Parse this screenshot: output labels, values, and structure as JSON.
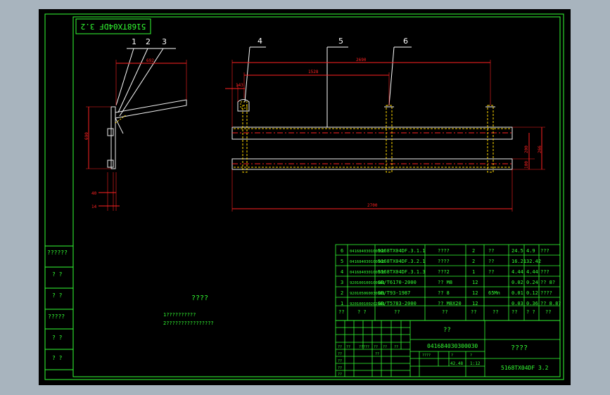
{
  "colors": {
    "background": "#000000",
    "frame": "#33ff33",
    "dimension": "#ff2222",
    "part_outline": "#f0f0f0",
    "weld": "#ffd700",
    "leader": "#ffffff"
  },
  "drawing_code_box": "5168TX04DF 3.2",
  "balloons": [
    "1",
    "2",
    "3",
    "4",
    "5",
    "6"
  ],
  "dimensions": {
    "side_top": "692",
    "side_height": "690",
    "side_bottom_1": "40",
    "side_bottom_2": "14",
    "front_2690": "2690",
    "front_1528": "1528",
    "front_143": "143",
    "front_2700": "2700",
    "right_200": "200",
    "right_100": "100",
    "right_266": "266"
  },
  "tech_req": {
    "title": "????",
    "lines": [
      "1??????????",
      "2????????????????"
    ]
  },
  "side_labels": [
    "??????",
    "? ?",
    "? ?",
    "?????",
    "? ?",
    "? ?"
  ],
  "bom_rows": [
    {
      "no": "6",
      "code": "041684030100050",
      "name": "5168TX04DF.3.1.1",
      "desc": "????",
      "qty": "2",
      "mat": "??",
      "unit": "24.5",
      "total": "4.9",
      "note": "???"
    },
    {
      "no": "5",
      "code": "041684030100060",
      "name": "5168TX04DF.3.2.1",
      "desc": "????",
      "qty": "2",
      "mat": "??",
      "unit": "16.21",
      "total": "32.42",
      "note": ""
    },
    {
      "no": "4",
      "code": "041684030100070",
      "name": "5168TX04DF.3.1.3",
      "desc": "???2",
      "qty": "1",
      "mat": "??",
      "unit": "4.44",
      "total": "4.44",
      "note": "???"
    },
    {
      "no": "3",
      "code": "920100100100381",
      "name": "GB/T6170-2000",
      "desc": "?? M8",
      "qty": "12",
      "mat": "",
      "unit": "0.02",
      "total": "0.24",
      "note": "?? 8?"
    },
    {
      "no": "2",
      "code": "920105060030381",
      "name": "GB/T93-1987",
      "desc": "?? 8",
      "qty": "12",
      "mat": "65Mn",
      "unit": "0.01",
      "total": "0.12",
      "note": "????"
    },
    {
      "no": "1",
      "code": "920100100202381",
      "name": "GB/T5783-2000",
      "desc": "?? M8X20",
      "qty": "12",
      "mat": "",
      "unit": "0.03",
      "total": "0.36",
      "note": "?? 8.8?"
    }
  ],
  "bom_header": [
    "??",
    "?  ?",
    "??",
    "??",
    "??",
    "??",
    "??",
    "? ?",
    "??"
  ],
  "title_block": {
    "part_name": "??",
    "drawing_no": "041684030300030",
    "company": "????",
    "drawing_code": "5168TX04DF 3.2",
    "weight": "42.48",
    "scale": "1:12",
    "r1": [
      "??",
      "??",
      "?????",
      "??",
      "??",
      "??"
    ],
    "r2": [
      "??",
      "",
      "??",
      "",
      "????",
      "?",
      "?"
    ],
    "r3": [
      "??",
      ""
    ],
    "r4": [
      "??",
      ""
    ],
    "r5": [
      "??",
      ""
    ]
  }
}
